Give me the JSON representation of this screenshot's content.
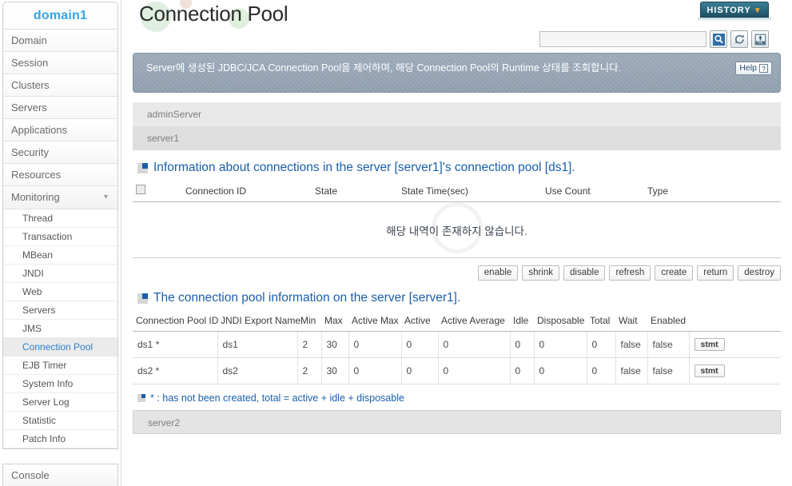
{
  "sidebar": {
    "domain_title": "domain1",
    "items": [
      {
        "label": "Domain"
      },
      {
        "label": "Session"
      },
      {
        "label": "Clusters"
      },
      {
        "label": "Servers"
      },
      {
        "label": "Applications"
      },
      {
        "label": "Security"
      },
      {
        "label": "Resources"
      },
      {
        "label": "Monitoring",
        "expanded": true,
        "chevron": "chevron-down-icon"
      }
    ],
    "monitoring_subitems": [
      {
        "label": "Thread",
        "active": false
      },
      {
        "label": "Transaction",
        "active": false
      },
      {
        "label": "MBean",
        "active": false
      },
      {
        "label": "JNDI",
        "active": false
      },
      {
        "label": "Web",
        "active": false
      },
      {
        "label": "Servers",
        "active": false
      },
      {
        "label": "JMS",
        "active": false
      },
      {
        "label": "Connection Pool",
        "active": true
      },
      {
        "label": "EJB Timer",
        "active": false
      },
      {
        "label": "System Info",
        "active": false
      },
      {
        "label": "Server Log",
        "active": false
      },
      {
        "label": "Statistic",
        "active": false
      },
      {
        "label": "Patch Info",
        "active": false
      }
    ],
    "console_label": "Console",
    "accent_color": "#35a4e8",
    "active_color": "#2a7fc9"
  },
  "header": {
    "page_title": "Connection Pool",
    "history_label": "HISTORY",
    "history_chevron": "▼",
    "history_accent": "#f5a623"
  },
  "search": {
    "value": "",
    "placeholder": "",
    "buttons": [
      {
        "icon": "search-icon",
        "title": "search"
      },
      {
        "icon": "refresh-icon",
        "title": "refresh"
      },
      {
        "icon": "xml-export-icon",
        "title": "xml"
      }
    ]
  },
  "description": {
    "text": "Server에 생성된 JDBC/JCA Connection Pool을 제어하며, 해당 Connection Pool의 Runtime 상태를 조회합니다.",
    "help_label": "Help",
    "help_mark": "?"
  },
  "servers": {
    "top": [
      {
        "name": "adminServer"
      },
      {
        "name": "server1"
      }
    ],
    "bottom": {
      "name": "server2"
    }
  },
  "connections_section": {
    "title": "Information about connections in the server [server1]'s connection pool [ds1].",
    "columns": [
      "",
      "Connection ID",
      "State",
      "State Time(sec)",
      "Use Count",
      "Type"
    ],
    "empty_message": "해당 내역이 존재하지 않습니다.",
    "rows": [],
    "actions": [
      "enable",
      "shrink",
      "disable",
      "refresh",
      "create",
      "return",
      "destroy"
    ]
  },
  "pool_section": {
    "title": "The connection pool information on the server [server1].",
    "columns": [
      "Connection Pool ID",
      "JNDI Export Name",
      "Min",
      "Max",
      "Active Max",
      "Active",
      "Active Average",
      "Idle",
      "Disposable",
      "Total",
      "Wait",
      "Enabled",
      ""
    ],
    "rows": [
      {
        "pool_id": "ds1 *",
        "jndi": "ds1",
        "min": "2",
        "max": "30",
        "active_max": "0",
        "active": "0",
        "active_avg": "0",
        "idle": "0",
        "disposable": "0",
        "total": "0",
        "wait": "false",
        "enabled": "false",
        "stmt_label": "stmt"
      },
      {
        "pool_id": "ds2 *",
        "jndi": "ds2",
        "min": "2",
        "max": "30",
        "active_max": "0",
        "active": "0",
        "active_avg": "0",
        "idle": "0",
        "disposable": "0",
        "total": "0",
        "wait": "false",
        "enabled": "false",
        "stmt_label": "stmt"
      }
    ],
    "footnote": "* : has not been created, total = active + idle + disposable"
  },
  "theme": {
    "section_heading_color": "#1a5faa",
    "icon_red": "#e32322",
    "icon_blue": "#1a5faa"
  }
}
